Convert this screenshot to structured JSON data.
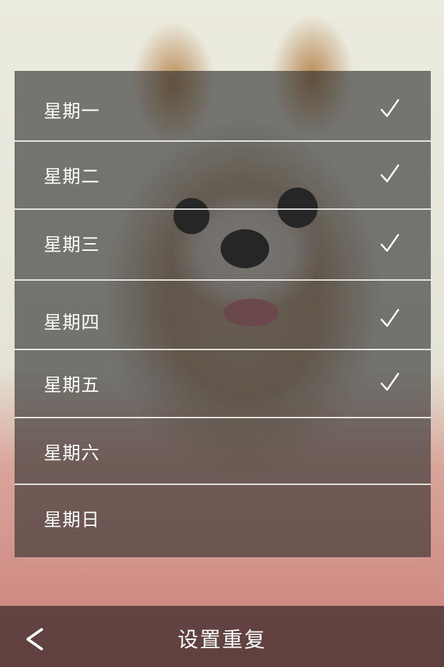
{
  "days": [
    {
      "label": "星期一",
      "checked": true
    },
    {
      "label": "星期二",
      "checked": true
    },
    {
      "label": "星期三",
      "checked": true
    },
    {
      "label": "星期四",
      "checked": true
    },
    {
      "label": "星期五",
      "checked": true
    },
    {
      "label": "星期六",
      "checked": false
    },
    {
      "label": "星期日",
      "checked": false
    }
  ],
  "bottom_bar": {
    "title": "设置重复",
    "back_icon": "back-arrow-icon"
  },
  "icons": {
    "check": "checkmark-icon"
  }
}
